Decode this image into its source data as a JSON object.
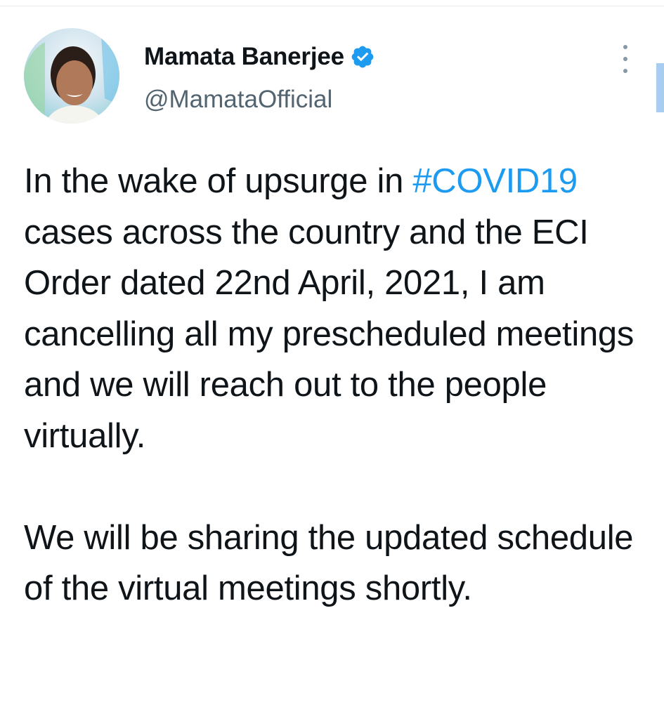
{
  "tweet": {
    "author": {
      "display_name": "Mamata Banerjee",
      "handle": "@MamataOfficial",
      "verified": true,
      "avatar_icon": "profile-photo"
    },
    "menu_icon": "more-vertical-icon",
    "text": {
      "para1_before": "In the wake of upsurge in ",
      "hashtag": "#COVID19",
      "para1_after": " cases across the country and the ECI Order dated 22nd April, 2021, I am cancelling all my prescheduled meetings and we will reach out to the people virtually.",
      "para2": "We will be sharing the updated schedule of the virtual meetings shortly."
    }
  },
  "colors": {
    "link": "#1d9bf0",
    "verified_badge": "#1d9bf0",
    "text_primary": "#0f1419",
    "text_secondary": "#536471"
  }
}
